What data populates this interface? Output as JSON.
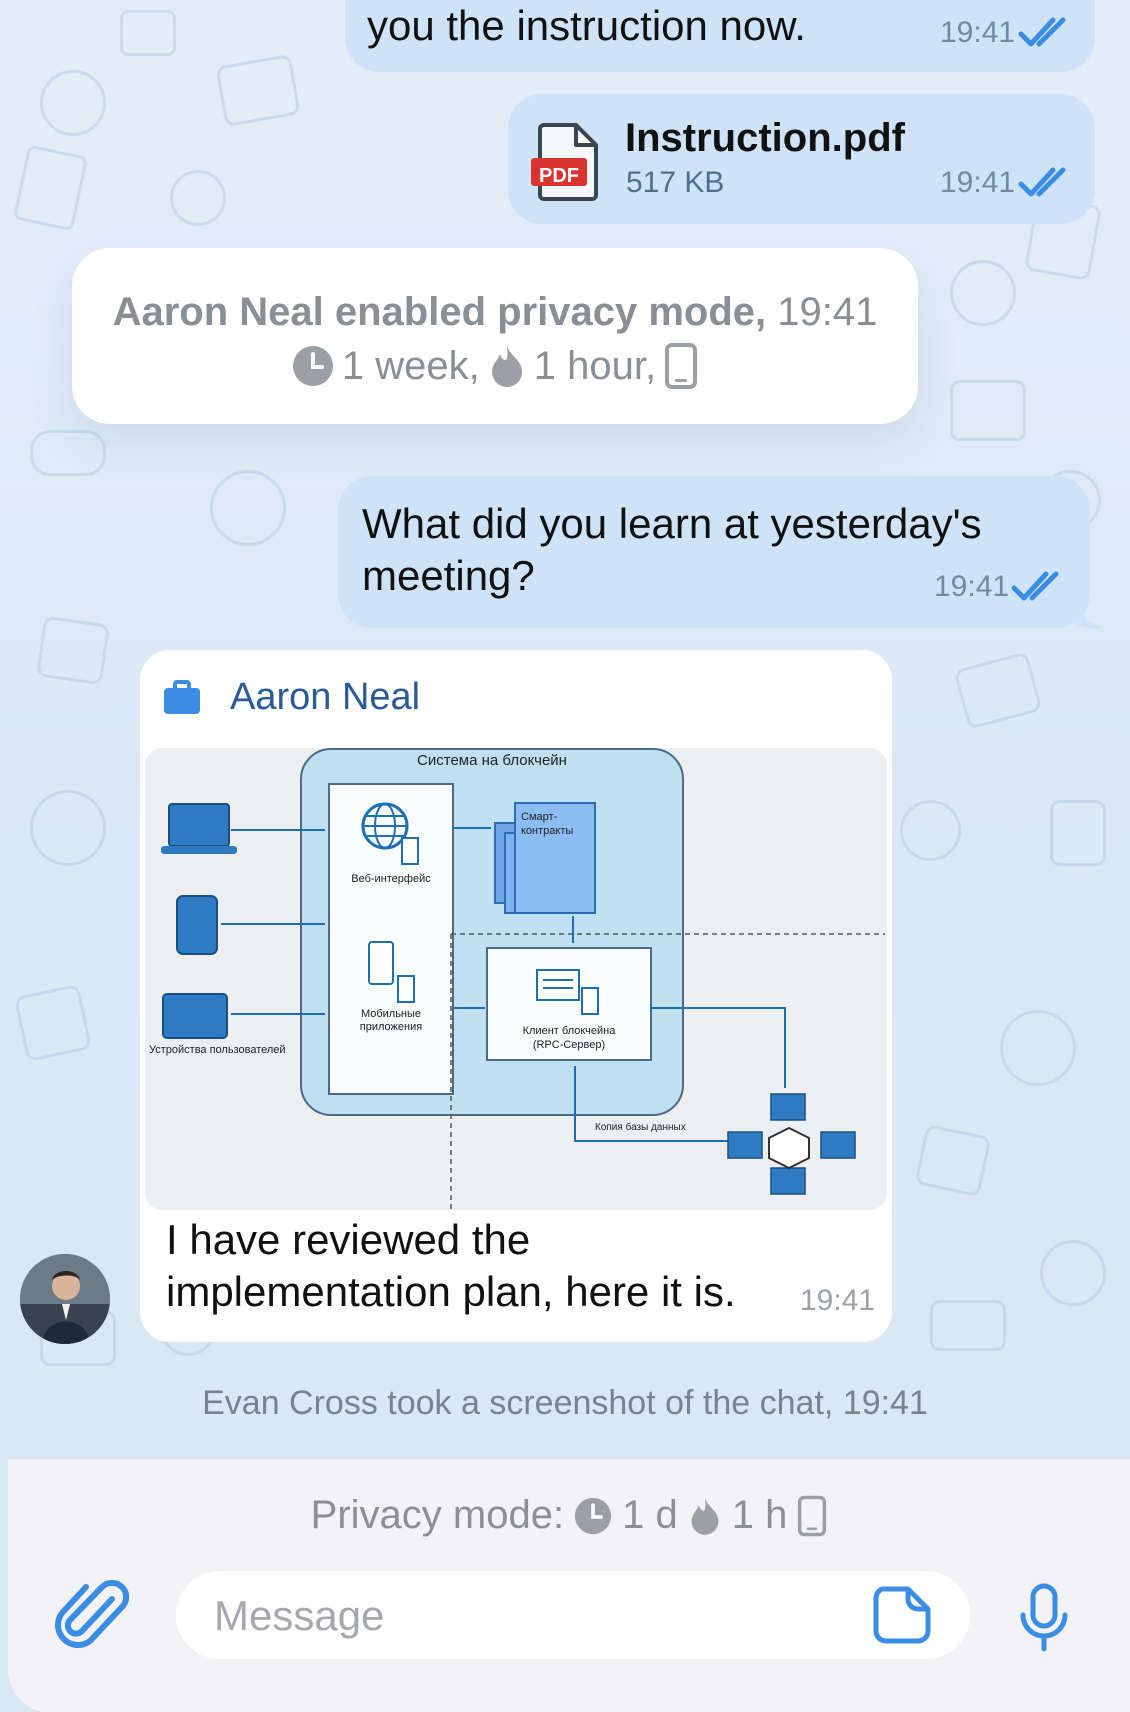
{
  "colors": {
    "bubble_out": "#cfe3f8",
    "bubble_in": "#ffffff",
    "accent": "#3a8de2",
    "name": "#2a5a97",
    "time": "#6f8aa6",
    "muted": "#8a8f96"
  },
  "messages": {
    "m1": {
      "text": "you the instruction now.",
      "time": "19:41"
    },
    "file": {
      "name": "Instruction.pdf",
      "size": "517 KB",
      "badge": "PDF",
      "time": "19:41"
    },
    "service": {
      "prefix": "Aaron Neal enabled privacy mode,",
      "time": "19:41",
      "week": "1 week,",
      "hour": "1 hour,"
    },
    "m2": {
      "text": "What did you learn at yesterday's meeting?",
      "time": "19:41"
    },
    "m3": {
      "sender": "Aaron Neal",
      "text": "I have reviewed the implementation plan, here it is.",
      "time": "19:41",
      "diagram": {
        "title": "Система на блокчейн",
        "web": "Веб-интерфейс",
        "mobile1": "Мобильные",
        "mobile2": "приложения",
        "contracts1": "Смарт-",
        "contracts2": "контракты",
        "client1": "Клиент блокчейна",
        "client2": "(RPC-Сервер)",
        "devices": "Устройства пользователей",
        "dbcopy": "Копия базы данных"
      }
    },
    "note": "Evan Cross took a screenshot of the chat, 19:41"
  },
  "bottom_bar": {
    "privacy_label": "Privacy mode:",
    "timer": "1 d",
    "burn": "1 h",
    "placeholder": "Message"
  }
}
